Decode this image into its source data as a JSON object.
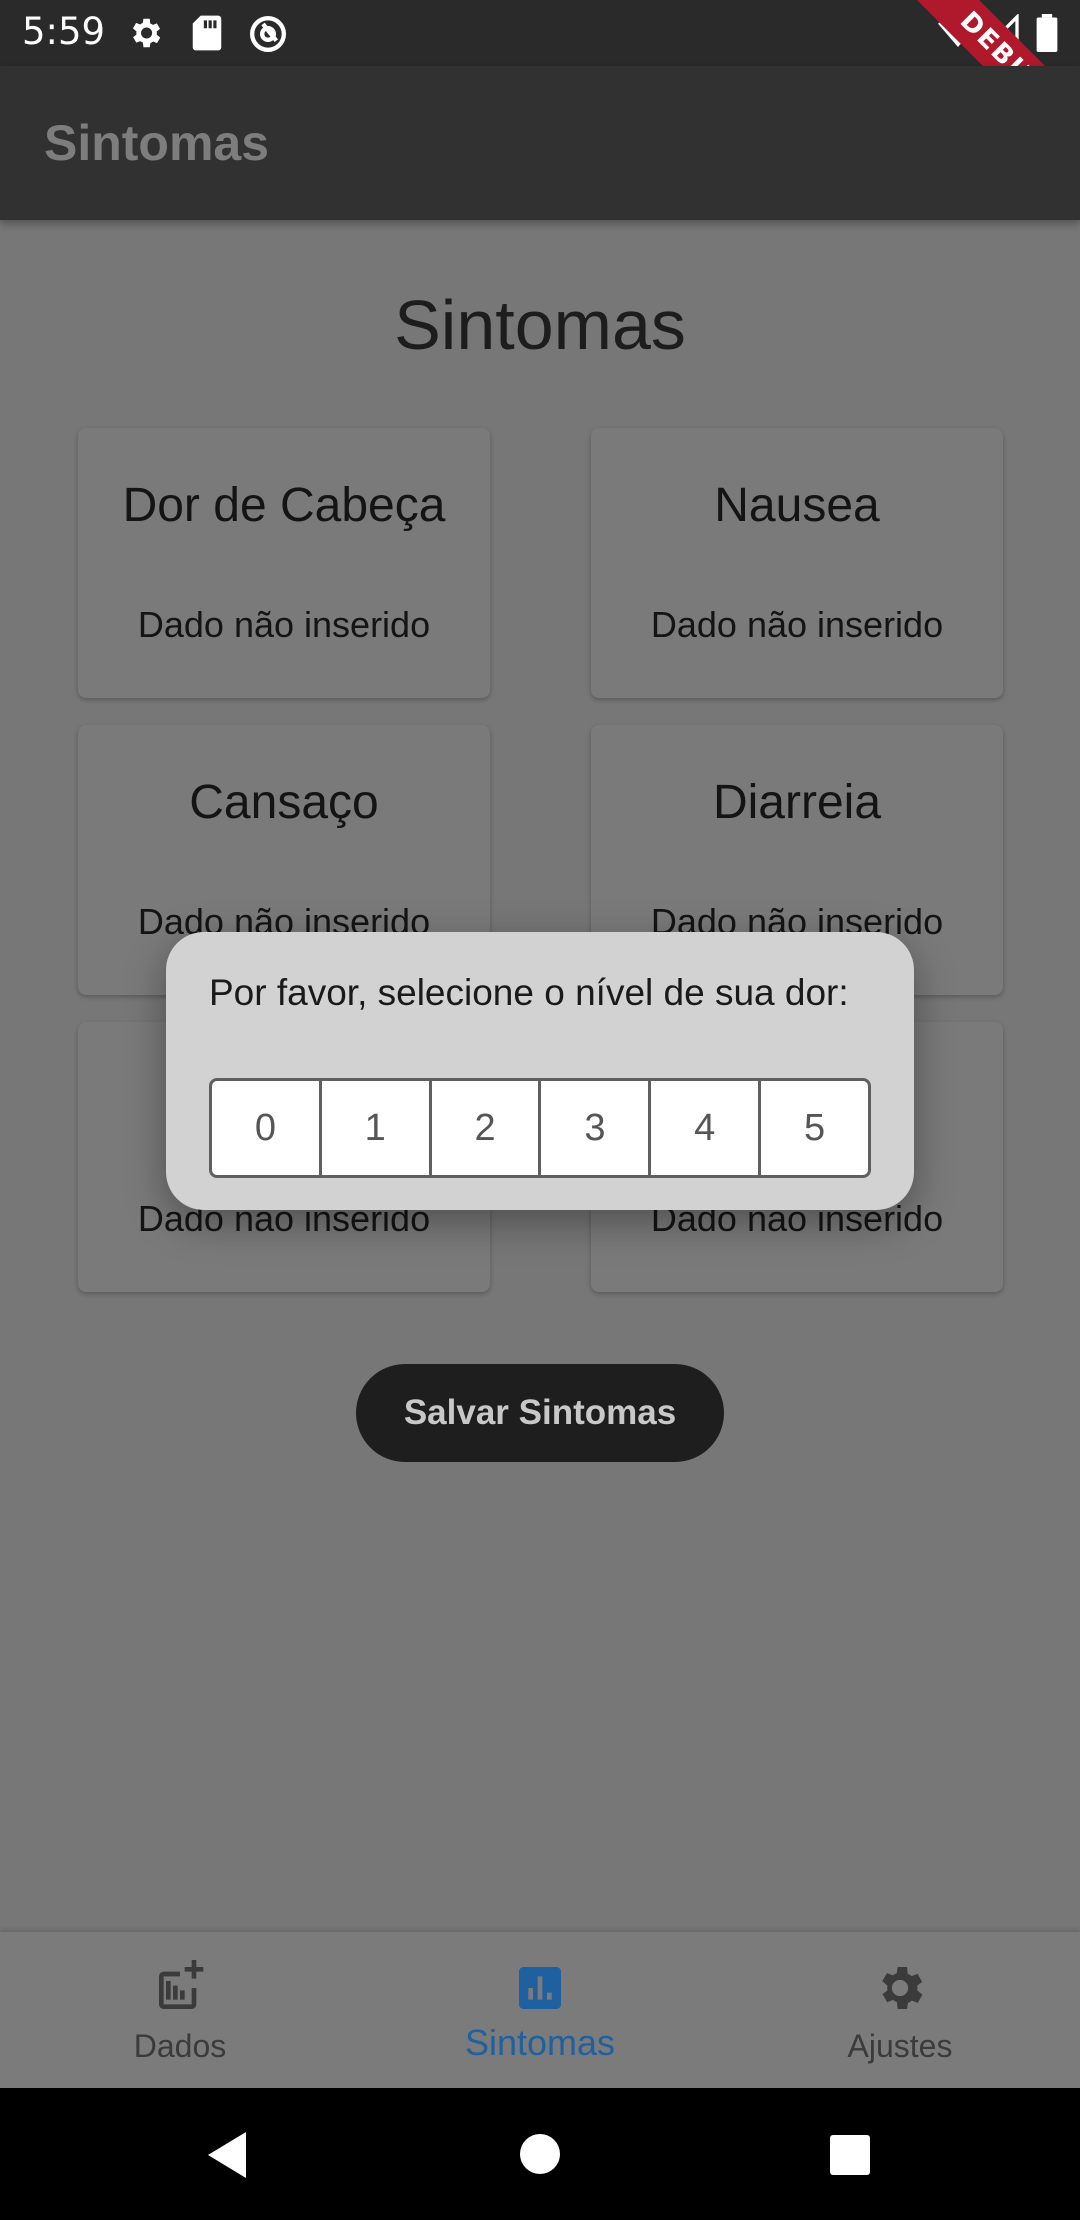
{
  "status_bar": {
    "time": "5:59",
    "debug_label": "DEBUG"
  },
  "app_bar": {
    "title": "Sintomas"
  },
  "page": {
    "title": "Sintomas"
  },
  "cards": [
    {
      "title": "Dor de Cabeça",
      "value": "Dado não inserido"
    },
    {
      "title": "Nausea",
      "value": "Dado não inserido"
    },
    {
      "title": "Cansaço",
      "value": "Dado não inserido"
    },
    {
      "title": "Diarreia",
      "value": "Dado não inserido"
    },
    {
      "title": "",
      "value": "Dado não inserido"
    },
    {
      "title": "",
      "value": "Dado não inserido"
    }
  ],
  "save_button": {
    "label": "Salvar Sintomas"
  },
  "dialog": {
    "prompt": "Por favor, selecione o nível de sua dor:",
    "levels": [
      "0",
      "1",
      "2",
      "3",
      "4",
      "5"
    ]
  },
  "bottom_nav": {
    "items": [
      {
        "label": "Dados",
        "icon": "add-chart-icon",
        "active": false
      },
      {
        "label": "Sintomas",
        "icon": "bar-chart-icon",
        "active": true
      },
      {
        "label": "Ajustes",
        "icon": "gear-icon",
        "active": false
      }
    ],
    "active_color": "#1e60a0"
  },
  "colors": {
    "dialog_bg": "#d2d2d2",
    "scrim": "#777777",
    "app_bar": "#313131"
  }
}
